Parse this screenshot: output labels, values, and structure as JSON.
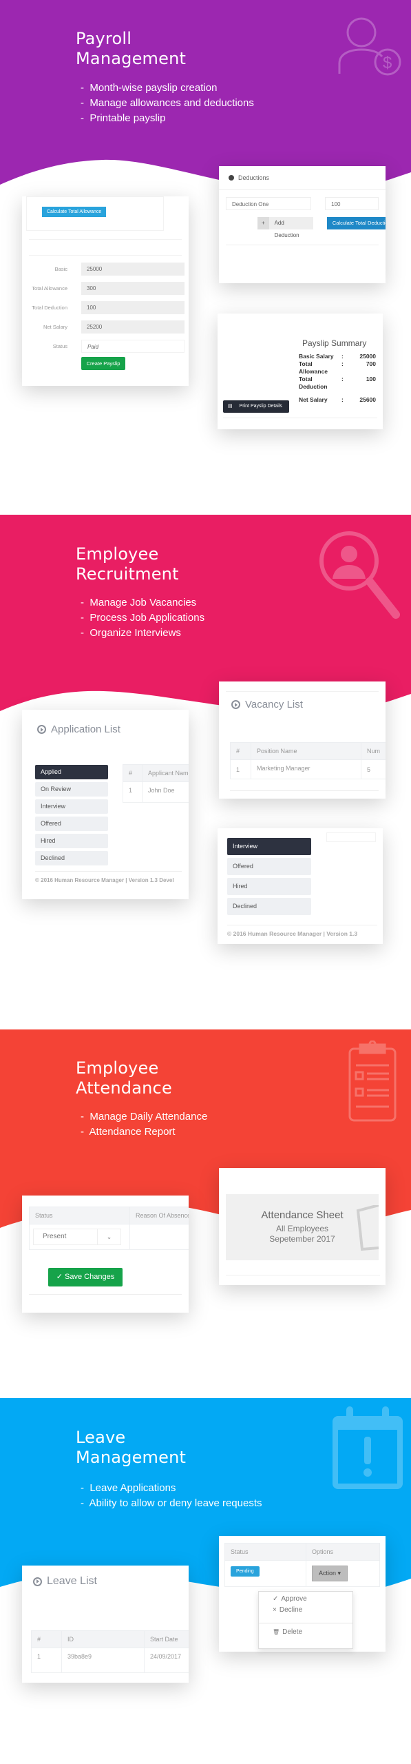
{
  "colors": {
    "payroll": "#9c27b0",
    "recruitment": "#e91e63",
    "attendance": "#f44336",
    "leave": "#03a9f4"
  },
  "payroll": {
    "title_line1": "Payroll",
    "title_line2": "Management",
    "bullets": [
      "Month-wise payslip creation",
      "Manage allowances and deductions",
      "Printable payslip"
    ],
    "icon": "employee-dollar-icon",
    "deductions_card": {
      "header": "Deductions",
      "name_value": "Deduction One",
      "amount_value": "100",
      "add_button": "Add Deduction",
      "add_icon": "+",
      "calc_button": "Calculate Total Deductions"
    },
    "salary_card": {
      "calc_allowance_button": "Calculate Total Allowance",
      "fields": [
        {
          "label": "Basic",
          "value": "25000"
        },
        {
          "label": "Total Allowance",
          "value": "300"
        },
        {
          "label": "Total Deduction",
          "value": "100"
        },
        {
          "label": "Net Salary",
          "value": "25200"
        },
        {
          "label": "Status",
          "value": "Paid"
        }
      ],
      "create_button": "Create Payslip"
    },
    "summary_card": {
      "title": "Payslip Summary",
      "rows": [
        {
          "label": "Basic Salary",
          "sep": ":",
          "value": "25000"
        },
        {
          "label": "Total Allowance",
          "sep": ":",
          "value": "700"
        },
        {
          "label": "Total Deduction",
          "sep": ":",
          "value": "100"
        },
        {
          "label": "Net Salary",
          "sep": ":",
          "value": "25600"
        }
      ],
      "print_button": "Print Payslip Details"
    }
  },
  "recruitment": {
    "title_line1": "Employee",
    "title_line2": "Recruitment",
    "bullets": [
      "Manage Job Vacancies",
      "Process Job Applications",
      "Organize Interviews"
    ],
    "icon": "magnifier-person-icon",
    "vacancy_card": {
      "header": "Vacancy List",
      "columns": [
        "#",
        "Position Name",
        "Num"
      ],
      "rows": [
        [
          "1",
          "Marketing Manager",
          "5"
        ]
      ]
    },
    "application_card": {
      "header": "Application List",
      "stages": [
        "Applied",
        "On Review",
        "Interview",
        "Offered",
        "Hired",
        "Declined"
      ],
      "active_stage": "Applied",
      "columns": [
        "#",
        "Applicant Name"
      ],
      "rows": [
        [
          "1",
          "John Doe"
        ]
      ],
      "footer": "© 2016 Human Resource Manager | Version 1.3 Devel"
    },
    "stage_card": {
      "stages": [
        "Interview",
        "Offered",
        "Hired",
        "Declined"
      ],
      "active_stage": "Interview",
      "footer": "© 2016 Human Resource Manager | Version 1.3"
    }
  },
  "attendance": {
    "title_line1": "Employee",
    "title_line2": "Attendance",
    "bullets": [
      "Manage Daily Attendance",
      "Attendance Report"
    ],
    "icon": "clipboard-checklist-icon",
    "sheet_card": {
      "title": "Attendance Sheet",
      "subtitle1": "All Employees",
      "subtitle2": "Sepetember 2017"
    },
    "status_card": {
      "columns": [
        "Status",
        "Reason Of Absence"
      ],
      "status_value": "Present",
      "save_button": "Save Changes"
    }
  },
  "leave": {
    "title_line1": "Leave",
    "title_line2": "Management",
    "bullets": [
      "Leave Applications",
      "Ability to allow or deny leave requests"
    ],
    "icon": "calendar-alert-icon",
    "action_card": {
      "columns": [
        "Status",
        "Options"
      ],
      "status_badge": "Pending",
      "action_button": "Action",
      "menu": [
        {
          "icon": "✓",
          "label": "Approve"
        },
        {
          "icon": "×",
          "label": "Decline"
        },
        {
          "icon": "🗑",
          "label": "Delete"
        }
      ]
    },
    "list_card": {
      "header": "Leave List",
      "columns": [
        "#",
        "ID",
        "Start Date"
      ],
      "rows": [
        [
          "1",
          "39ba8e9",
          "24/09/2017"
        ]
      ]
    }
  }
}
